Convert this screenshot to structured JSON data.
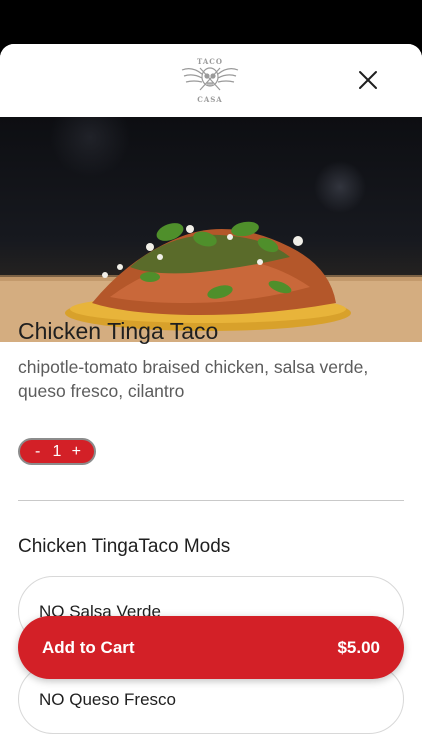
{
  "header": {
    "logo_top_text": "TACO",
    "logo_bottom_text": "CASA",
    "logo_icon": "winged-skull-icon",
    "close_icon": "close-icon"
  },
  "item": {
    "image_icon": "taco-photo",
    "title": "Chicken Tinga Taco",
    "description": "chipotle-tomato braised chicken, salsa verde, queso fresco, cilantro"
  },
  "quantity": {
    "minus_label": "-",
    "value": "1",
    "plus_label": "+"
  },
  "mods": {
    "title": "Chicken TingaTaco Mods",
    "options": [
      {
        "label": "NO Salsa Verde"
      },
      {
        "label": "NO Queso Fresco"
      }
    ]
  },
  "cart": {
    "label": "Add to Cart",
    "price": "$5.00"
  },
  "colors": {
    "accent": "#d32027",
    "text": "#1f1f1f",
    "muted_text": "#5c5c5c"
  }
}
